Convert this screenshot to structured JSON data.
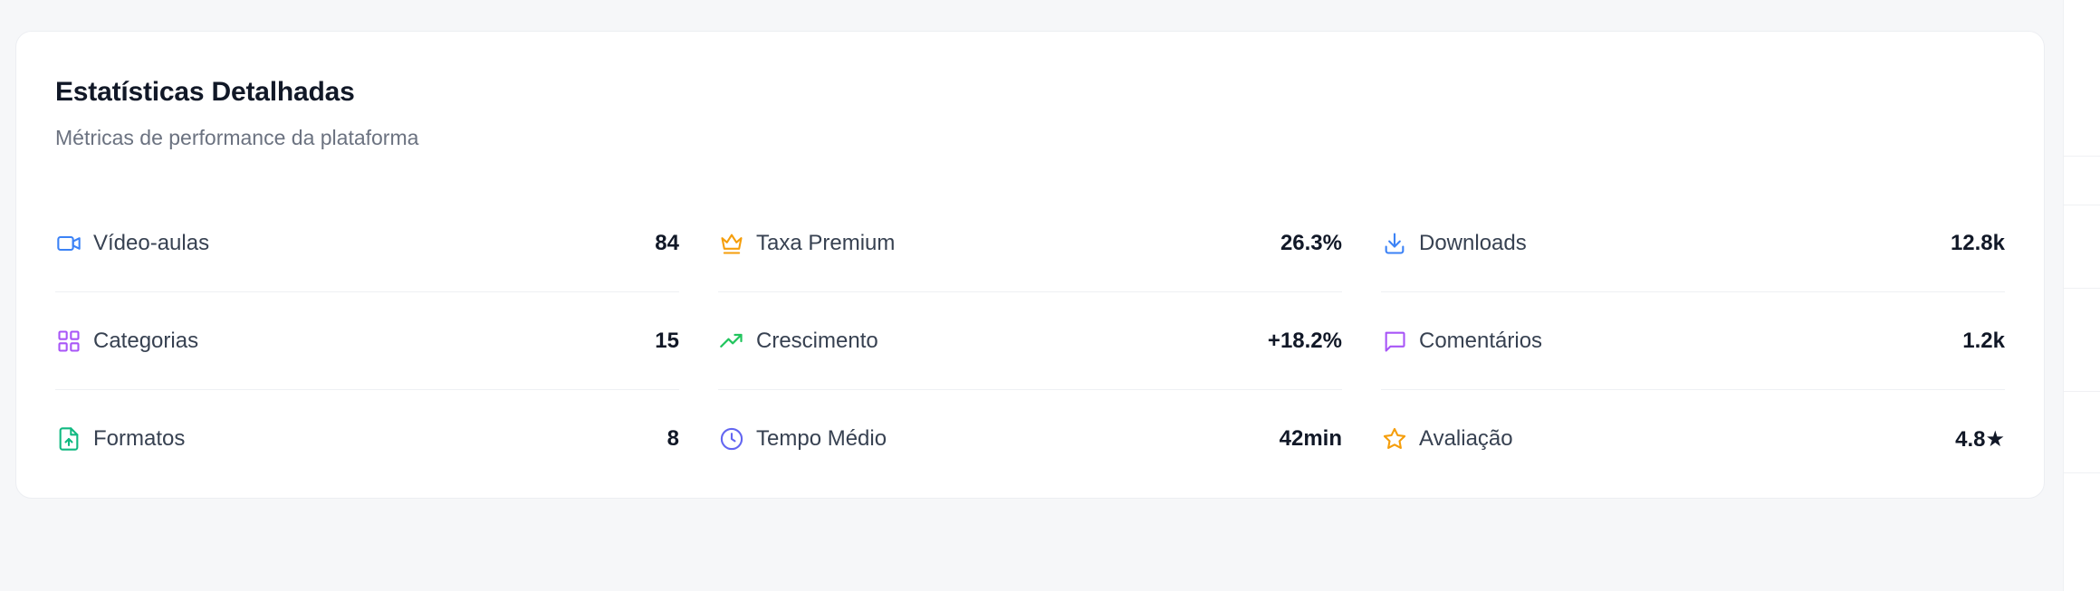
{
  "card": {
    "title": "Estatísticas Detalhadas",
    "subtitle": "Métricas de performance da plataforma"
  },
  "stats": [
    {
      "label": "Vídeo-aulas",
      "value": "84",
      "icon": "video-icon",
      "color": "#3b82f6"
    },
    {
      "label": "Categorias",
      "value": "15",
      "icon": "grid-icon",
      "color": "#a855f7"
    },
    {
      "label": "Formatos",
      "value": "8",
      "icon": "file-upload-icon",
      "color": "#10b981"
    },
    {
      "label": "Taxa Premium",
      "value": "26.3%",
      "icon": "crown-icon",
      "color": "#f59e0b"
    },
    {
      "label": "Crescimento",
      "value": "+18.2%",
      "icon": "trending-up-icon",
      "color": "#22c55e"
    },
    {
      "label": "Tempo Médio",
      "value": "42min",
      "icon": "clock-icon",
      "color": "#6366f1"
    },
    {
      "label": "Downloads",
      "value": "12.8k",
      "icon": "download-icon",
      "color": "#3b82f6"
    },
    {
      "label": "Comentários",
      "value": "1.2k",
      "icon": "message-icon",
      "color": "#a855f7"
    },
    {
      "label": "Avaliação",
      "value": "4.8★",
      "icon": "star-icon",
      "color": "#f59e0b"
    }
  ]
}
